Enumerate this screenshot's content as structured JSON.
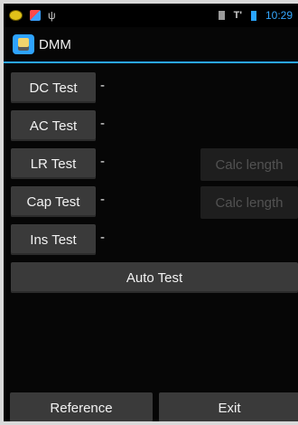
{
  "status_bar": {
    "time": "10:29",
    "icons": [
      "notification-dot-icon",
      "app-notification-icon",
      "usb-icon",
      "sim-icon",
      "signal-icon",
      "battery-icon"
    ]
  },
  "action_bar": {
    "title": "DMM"
  },
  "tests": [
    {
      "label": "DC Test",
      "value": "-"
    },
    {
      "label": "AC Test",
      "value": "-"
    },
    {
      "label": "LR Test",
      "value": "-",
      "side_label": "Calc length"
    },
    {
      "label": "Cap Test",
      "value": "-",
      "side_label": "Calc length"
    },
    {
      "label": "Ins Test",
      "value": "-"
    }
  ],
  "auto_test": {
    "label": "Auto Test"
  },
  "bottom": {
    "reference_label": "Reference",
    "exit_label": "Exit"
  },
  "colors": {
    "accent": "#2aa6ff",
    "button_bg": "#3a3a3a",
    "disabled_text": "#525252"
  }
}
